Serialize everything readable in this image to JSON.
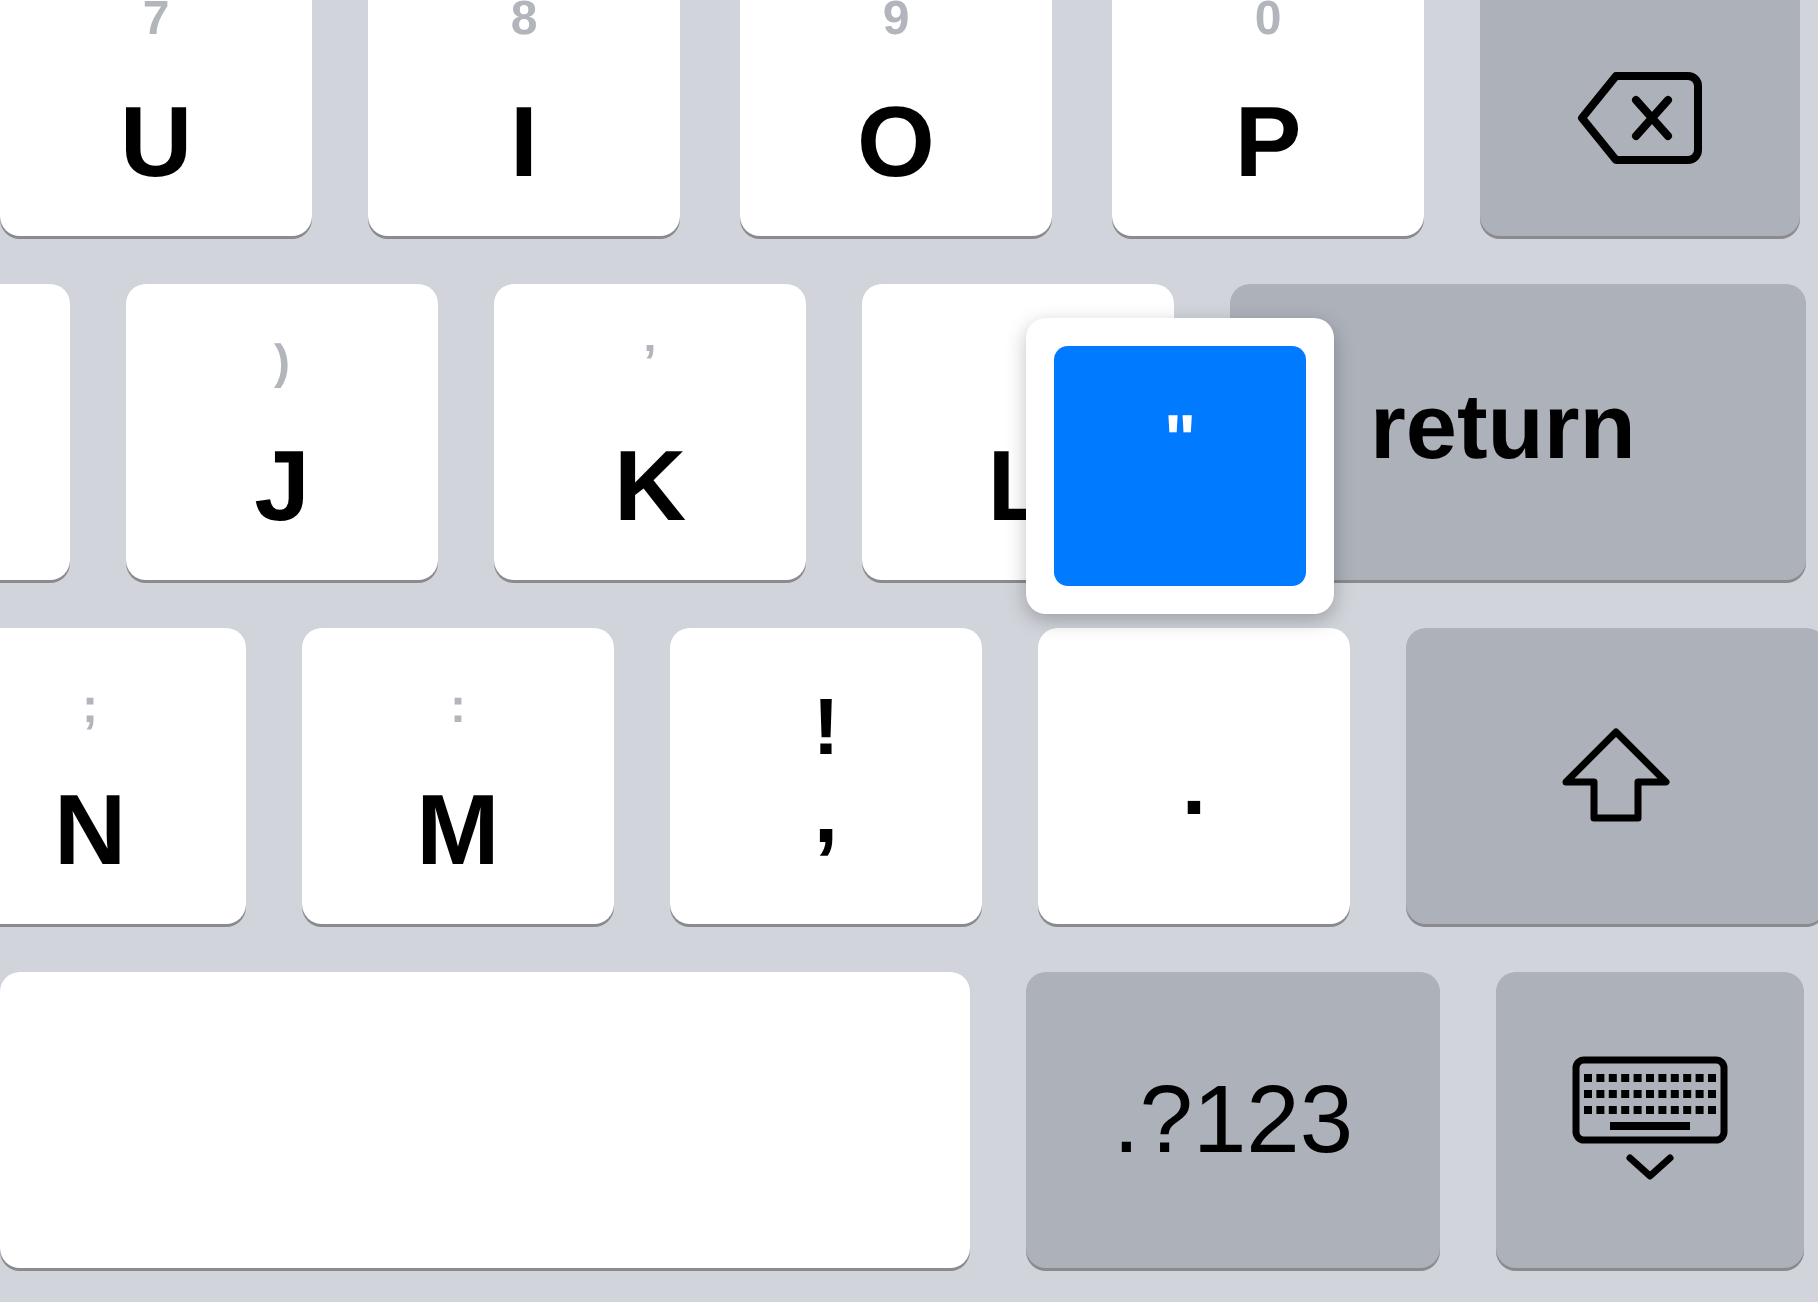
{
  "rows": [
    {
      "keys": [
        {
          "kind": "letter",
          "label": "U",
          "hint": "7"
        },
        {
          "kind": "letter",
          "label": "I",
          "hint": "8"
        },
        {
          "kind": "letter",
          "label": "O",
          "hint": "9"
        },
        {
          "kind": "letter",
          "label": "P",
          "hint": "0"
        },
        {
          "kind": "delete"
        }
      ]
    },
    {
      "keys": [
        {
          "kind": "blank"
        },
        {
          "kind": "letter",
          "label": "J",
          "hint": ")"
        },
        {
          "kind": "letter",
          "label": "K",
          "hint": "’"
        },
        {
          "kind": "letter",
          "label": "L"
        },
        {
          "kind": "return",
          "label": "return"
        }
      ]
    },
    {
      "keys": [
        {
          "kind": "letter",
          "label": "N",
          "hint": ";"
        },
        {
          "kind": "letter",
          "label": "M",
          "hint": ":"
        },
        {
          "kind": "punct",
          "label": ",",
          "hint": "!"
        },
        {
          "kind": "punct",
          "label": "."
        },
        {
          "kind": "shift",
          "on": false
        }
      ]
    },
    {
      "keys": [
        {
          "kind": "space"
        },
        {
          "kind": "numbers",
          "label": ".?123"
        },
        {
          "kind": "dismiss"
        }
      ]
    }
  ],
  "popup": {
    "label": "\""
  }
}
